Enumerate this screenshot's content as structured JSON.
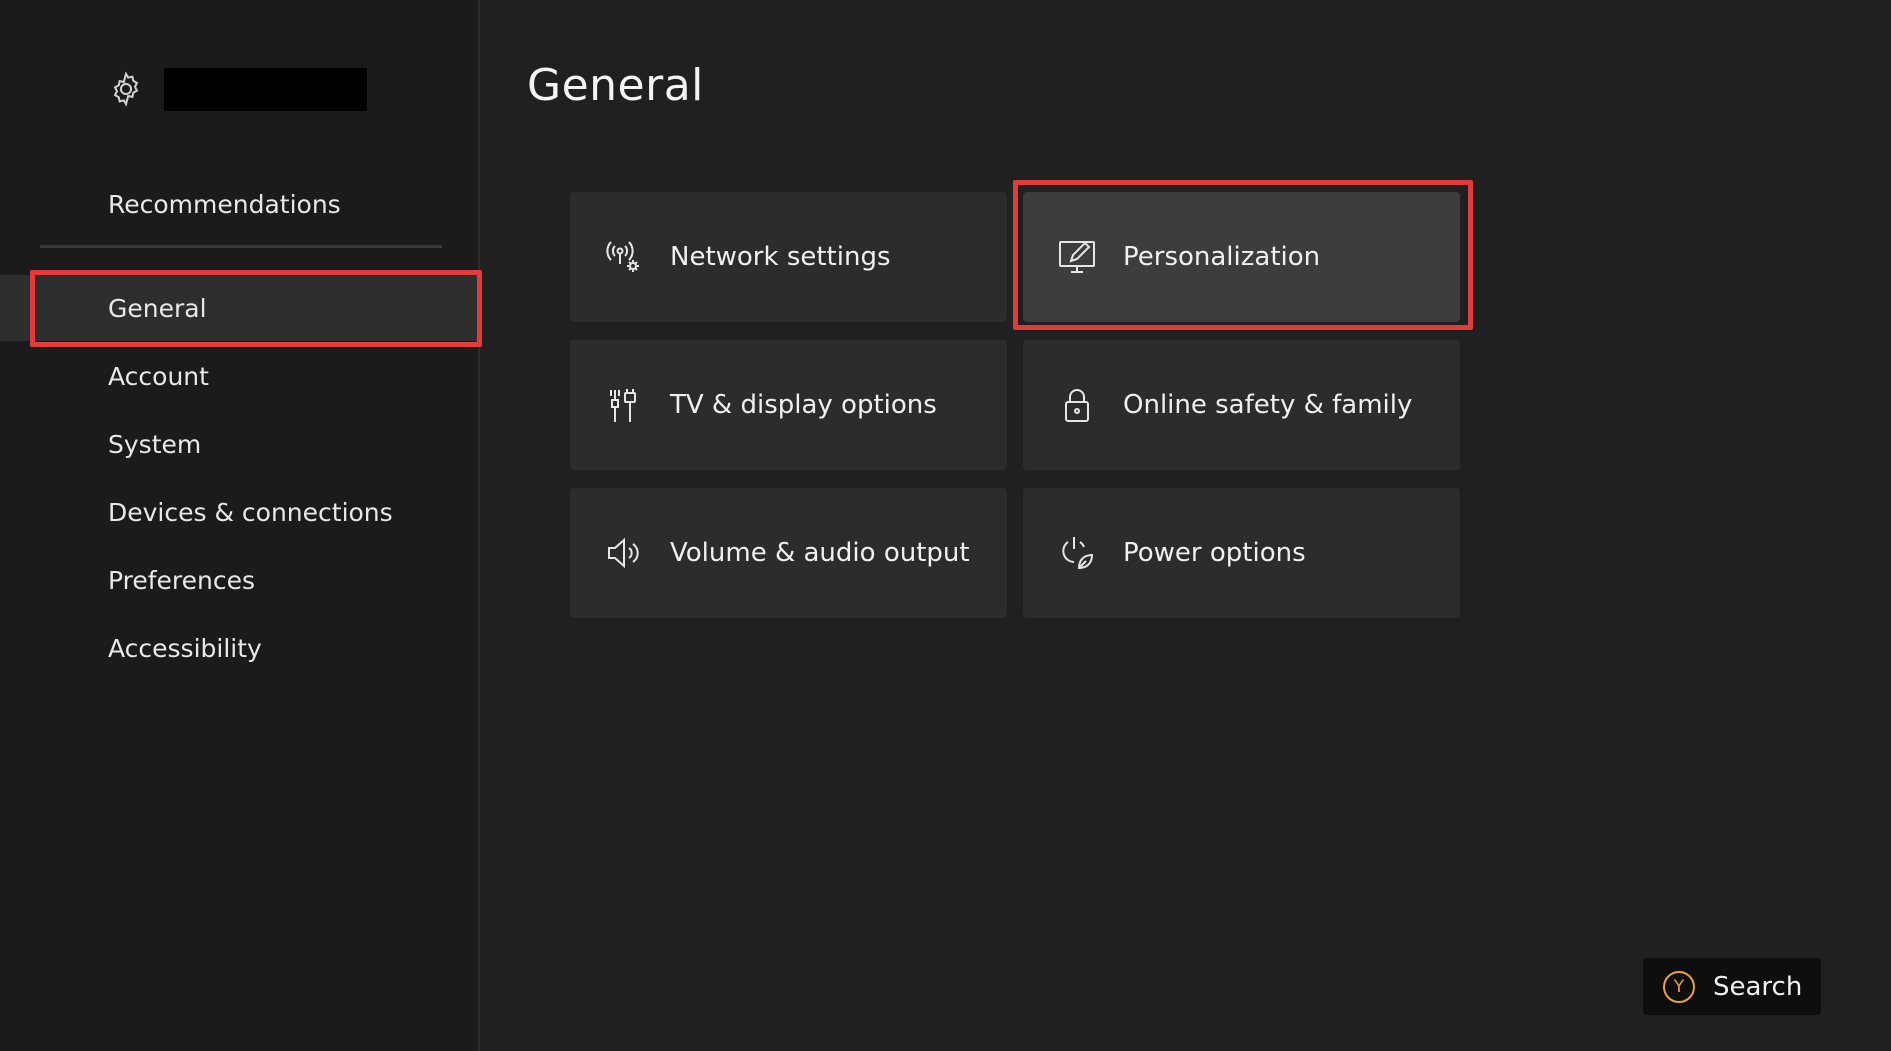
{
  "sidebar": {
    "recommendations_label": "Recommendations",
    "items": [
      {
        "label": "General",
        "selected": true
      },
      {
        "label": "Account"
      },
      {
        "label": "System"
      },
      {
        "label": "Devices & connections"
      },
      {
        "label": "Preferences"
      },
      {
        "label": "Accessibility"
      }
    ]
  },
  "main": {
    "title": "General",
    "tiles": [
      {
        "label": "Network settings",
        "icon": "network-settings-icon"
      },
      {
        "label": "Personalization",
        "icon": "personalization-icon",
        "focused": true
      },
      {
        "label": "TV & display options",
        "icon": "tv-display-icon"
      },
      {
        "label": "Online safety & family",
        "icon": "lock-icon"
      },
      {
        "label": "Volume & audio output",
        "icon": "speaker-icon"
      },
      {
        "label": "Power options",
        "icon": "power-leaf-icon"
      }
    ]
  },
  "search": {
    "button_glyph": "Y",
    "label": "Search"
  },
  "colors": {
    "highlight": "#e23b3b",
    "y_button": "#e8a33a",
    "background": "#202020"
  }
}
